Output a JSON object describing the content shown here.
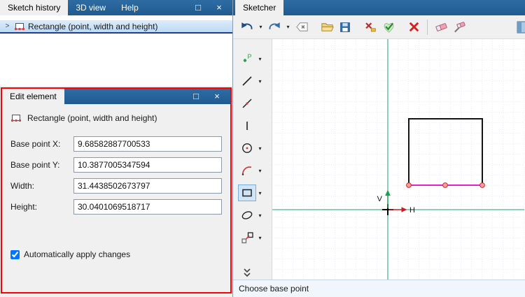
{
  "glyphs": {
    "dropdown": "▾",
    "expander": ">",
    "maximize": "□",
    "close": "×"
  },
  "colors": {
    "titlebar_blue": "#215c91",
    "selection_blue": "#c6def5",
    "red_outline": "#ff0000",
    "axis_green": "#21a06d",
    "base_edge_magenta": "#e820c8",
    "handle_fill": "#ff9a9a",
    "handle_stroke": "#c23030"
  },
  "history_panel": {
    "tabs": [
      {
        "label": "Sketch history",
        "active": true
      },
      {
        "label": "3D view",
        "active": false
      },
      {
        "label": "Help",
        "active": false
      }
    ],
    "tree": {
      "items": [
        {
          "label": "Rectangle (point, width and height)",
          "selected": true
        }
      ]
    }
  },
  "edit_panel": {
    "title": "Edit element",
    "element_type": "Rectangle (point, width and height)",
    "fields": [
      {
        "label": "Base point X:",
        "value": "9.68582887700533"
      },
      {
        "label": "Base point Y:",
        "value": "10.3877005347594"
      },
      {
        "label": "Width:",
        "value": "31.4438502673797"
      },
      {
        "label": "Height:",
        "value": "30.0401069518717"
      }
    ],
    "auto_apply": {
      "label": "Automatically apply changes",
      "checked": true
    }
  },
  "sketcher": {
    "tab": "Sketcher",
    "toolbar_icons": [
      "undo-icon",
      "undo-dropdown",
      "redo-icon",
      "redo-dropdown",
      "backspace-icon",
      "open-icon",
      "save-icon",
      "delete-icon",
      "accept-icon",
      "cancel-icon",
      "eraser-icon",
      "eraser-pencil-icon",
      "panel-partial-icon"
    ],
    "tool_icons": [
      "point",
      "line",
      "polyline",
      "segment",
      "circle",
      "arc",
      "rectangle",
      "ellipse",
      "transform",
      "more-tools"
    ],
    "active_tool": "rectangle",
    "canvas": {
      "v_label": "V",
      "h_label": "H"
    },
    "status": "Choose base point"
  }
}
